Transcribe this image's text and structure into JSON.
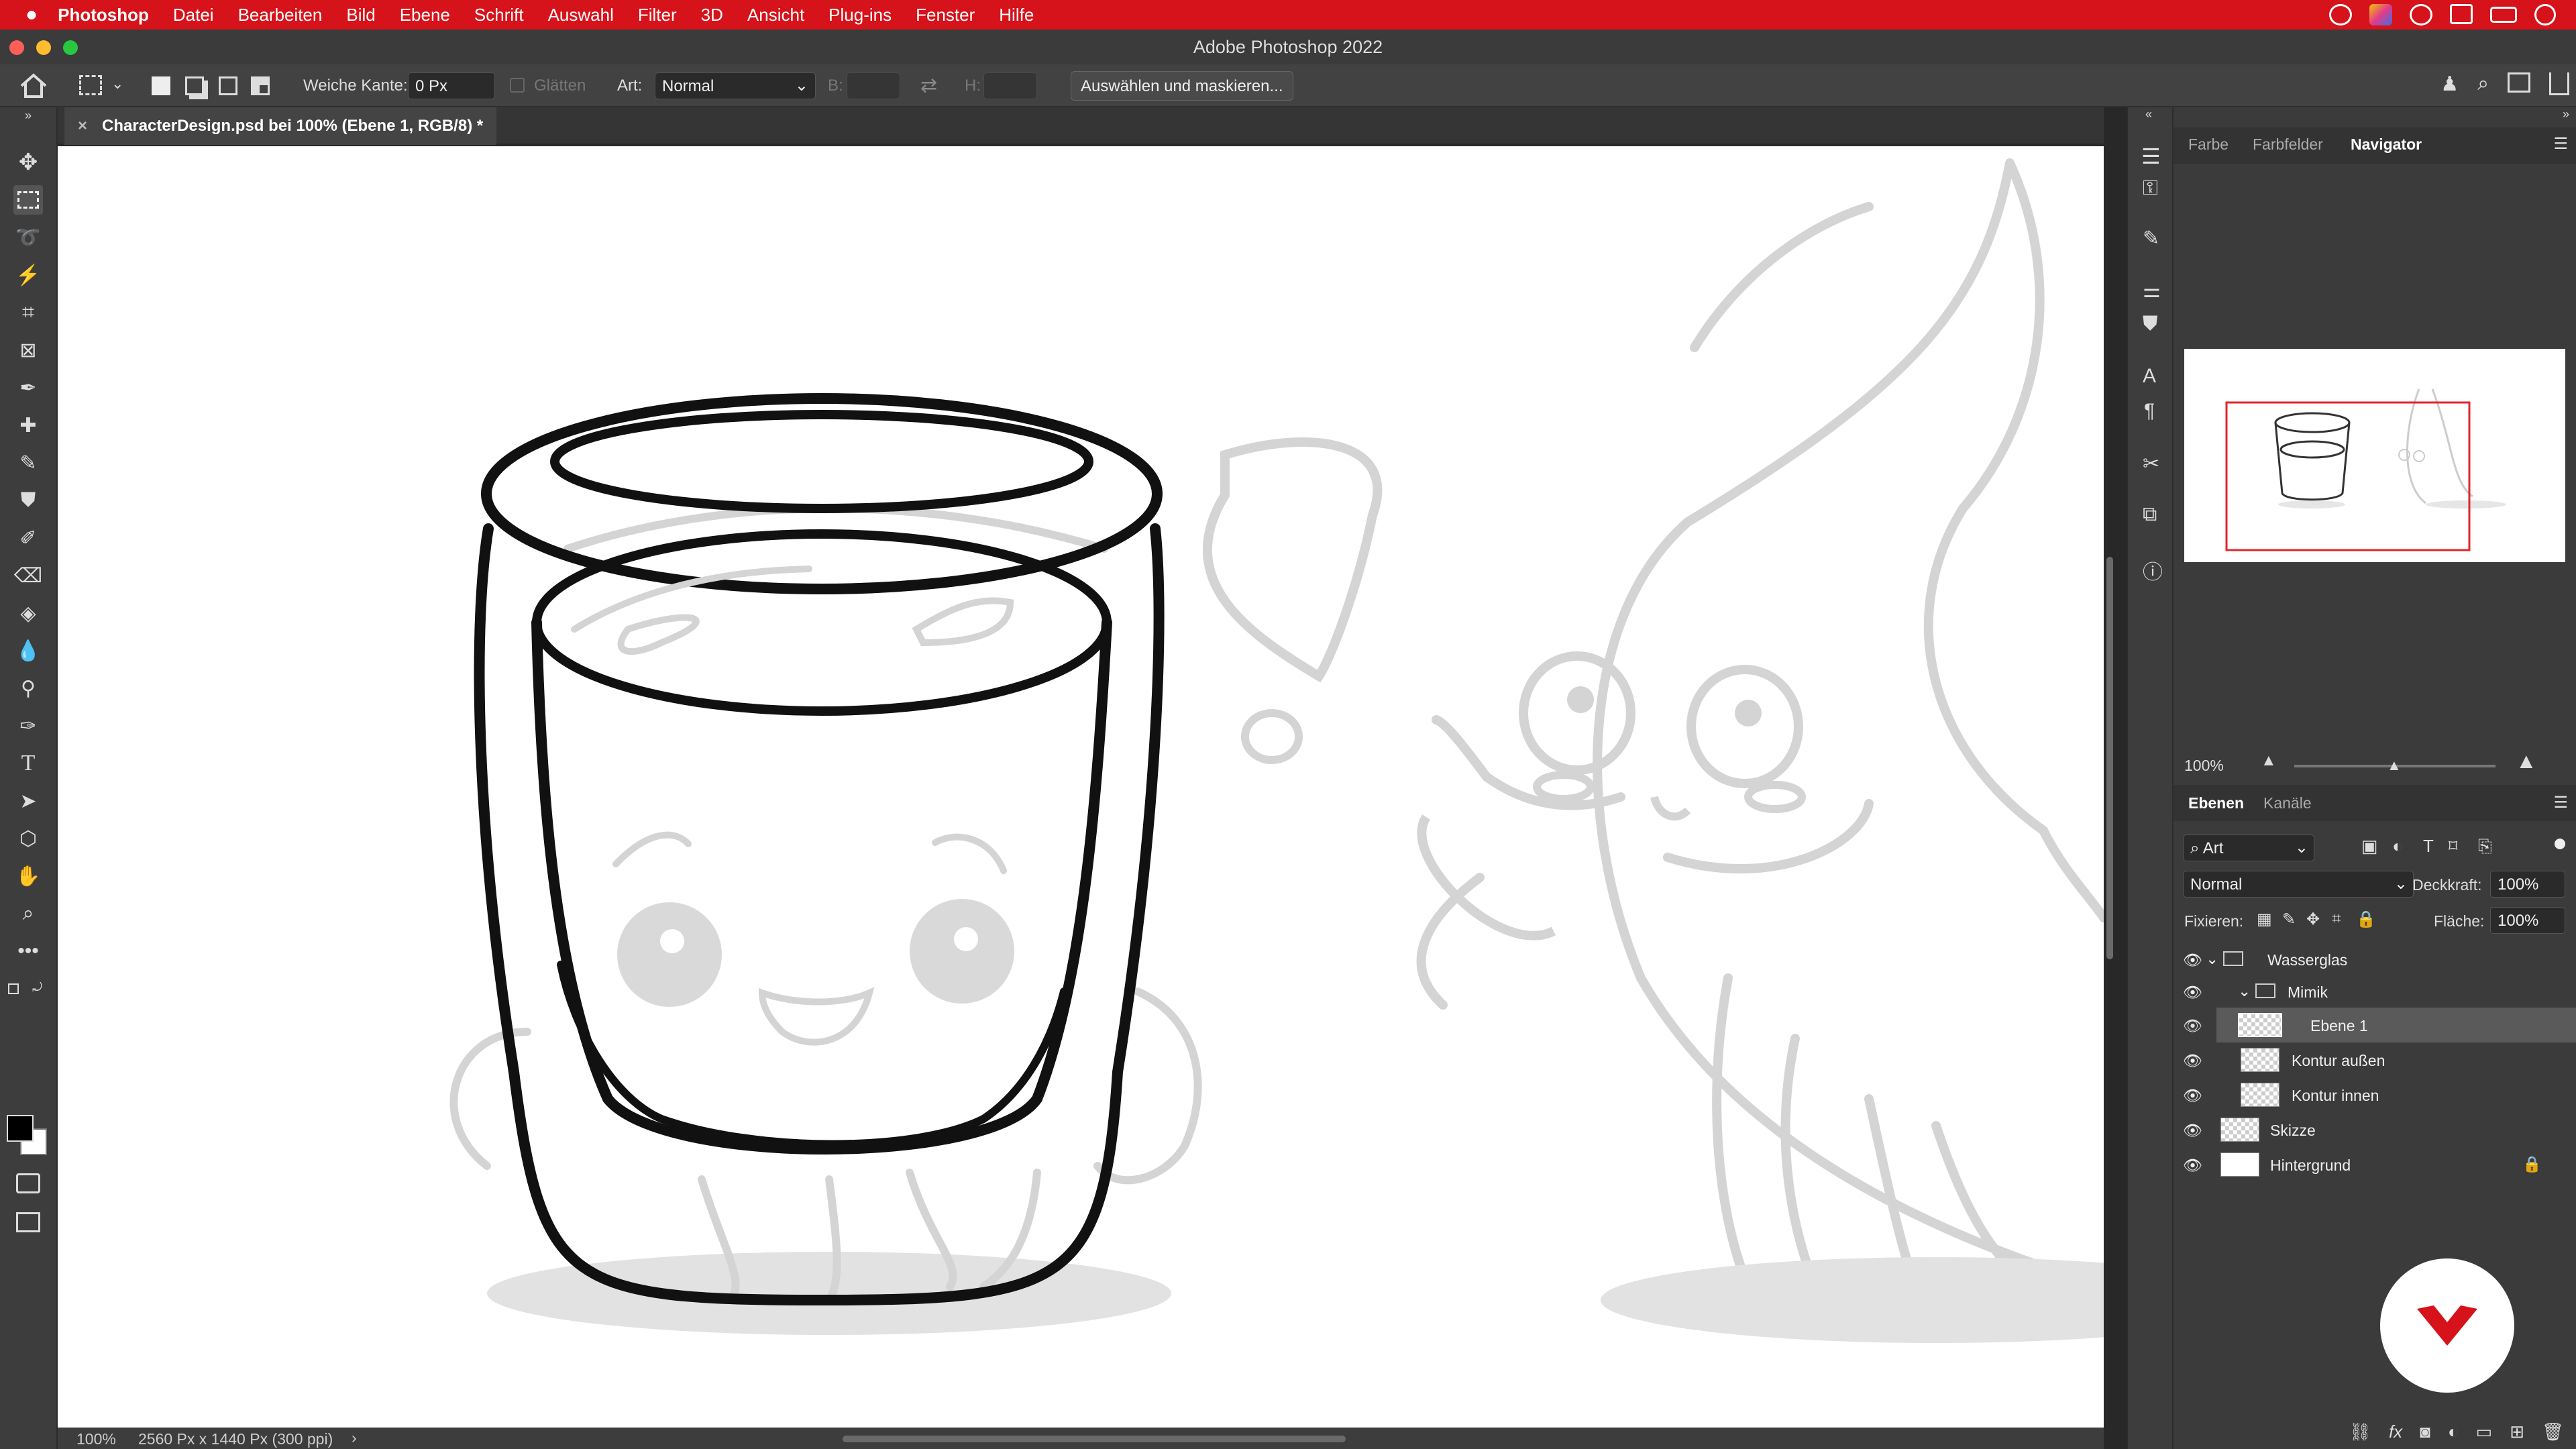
{
  "menubar": {
    "app_name": "Photoshop",
    "items": [
      "Datei",
      "Bearbeiten",
      "Bild",
      "Ebene",
      "Schrift",
      "Auswahl",
      "Filter",
      "3D",
      "Ansicht",
      "Plug-ins",
      "Fenster",
      "Hilfe"
    ]
  },
  "window": {
    "title": "Adobe Photoshop 2022"
  },
  "options": {
    "feather_label": "Weiche Kante:",
    "feather_value": "0 Px",
    "antialias_label": "Glätten",
    "style_label": "Art:",
    "style_value": "Normal",
    "width_label": "B:",
    "height_label": "H:",
    "select_mask_button": "Auswählen und maskieren..."
  },
  "document": {
    "tab_title": "CharacterDesign.psd bei 100% (Ebene 1, RGB/8) *",
    "zoom": "100%",
    "info": "2560 Px x 1440 Px (300 ppi)"
  },
  "panels": {
    "top_tabs": [
      "Farbe",
      "Farbfelder",
      "Navigator"
    ],
    "navigator_zoom": "100%",
    "layer_tabs": [
      "Ebenen",
      "Kanäle"
    ],
    "filter_kind": "Art",
    "blend_mode": "Normal",
    "opacity_label": "Deckkraft:",
    "opacity_value": "100%",
    "lock_label": "Fixieren:",
    "fill_label": "Fläche:",
    "fill_value": "100%"
  },
  "layers": [
    {
      "name": "Wasserglas",
      "type": "group"
    },
    {
      "name": "Mimik",
      "type": "group"
    },
    {
      "name": "Ebene 1",
      "type": "layer",
      "selected": true
    },
    {
      "name": "Kontur außen",
      "type": "layer"
    },
    {
      "name": "Kontur innen",
      "type": "layer"
    },
    {
      "name": "Skizze",
      "type": "layer"
    },
    {
      "name": "Hintergrund",
      "type": "background",
      "locked": true
    }
  ],
  "colors": {
    "menubar": "#d6121a",
    "accent_logo": "#d6121a",
    "navigator_frame": "#e0262b"
  }
}
